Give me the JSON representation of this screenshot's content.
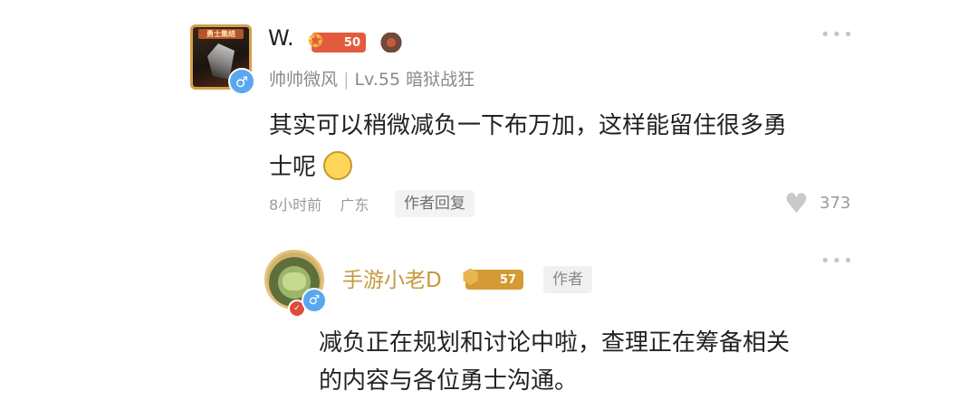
{
  "comment": {
    "username": "W.",
    "level_badge": "50",
    "guild": "帅帅微风",
    "separator": "|",
    "player_level": "Lv.55",
    "player_class": "暗狱战狂",
    "avatar_banner": "勇士集结",
    "text": "其实可以稍微减负一下布万加，这样能留住很多勇士呢",
    "time": "8小时前",
    "location": "广东",
    "author_reply_label": "作者回复",
    "likes": "373",
    "more": "•••"
  },
  "reply": {
    "username": "手游小老D",
    "level_badge": "57",
    "author_tag": "作者",
    "text": "减负正在规划和讨论中啦，查理正在筹备相关的内容与各位勇士沟通。",
    "more": "•••"
  },
  "icons": {
    "gender": "♂",
    "heart": "♥",
    "emoji": "worried-face",
    "rank": "medal"
  },
  "colors": {
    "level_badge_1": "#e35b3c",
    "level_badge_2": "#d39a35",
    "reply_name": "#c59a3e",
    "gender_badge": "#5aa7f0"
  }
}
